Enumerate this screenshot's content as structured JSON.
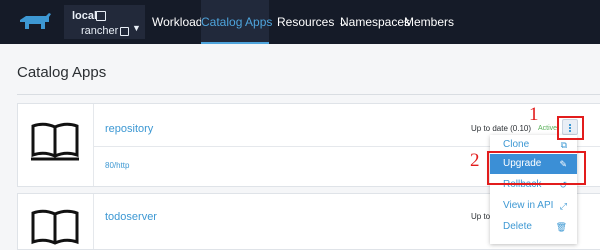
{
  "topbar": {
    "cluster": "local",
    "project": "rancher",
    "nav": [
      "Workloads",
      "Catalog Apps",
      "Resources",
      "Namespaces",
      "Members"
    ],
    "active": "Catalog Apps",
    "resources_caret": "⌄"
  },
  "page": {
    "title": "Catalog Apps"
  },
  "apps": [
    {
      "name": "repository",
      "status": "Up to date (0.10)",
      "state": "Active",
      "endpoint": "80/http"
    },
    {
      "name": "todoserver",
      "status": "Up to"
    }
  ],
  "menu": {
    "items": [
      "Clone",
      "Upgrade",
      "Rollback",
      "View in API",
      "Delete"
    ]
  },
  "annotations": {
    "first": "1",
    "second": "2"
  },
  "colors": {
    "topbar": "#151b28",
    "accent": "#3d98d3",
    "highlight": "#3b8fd6",
    "annotation": "#e21c1c",
    "active_badge": "#5ab15a"
  }
}
